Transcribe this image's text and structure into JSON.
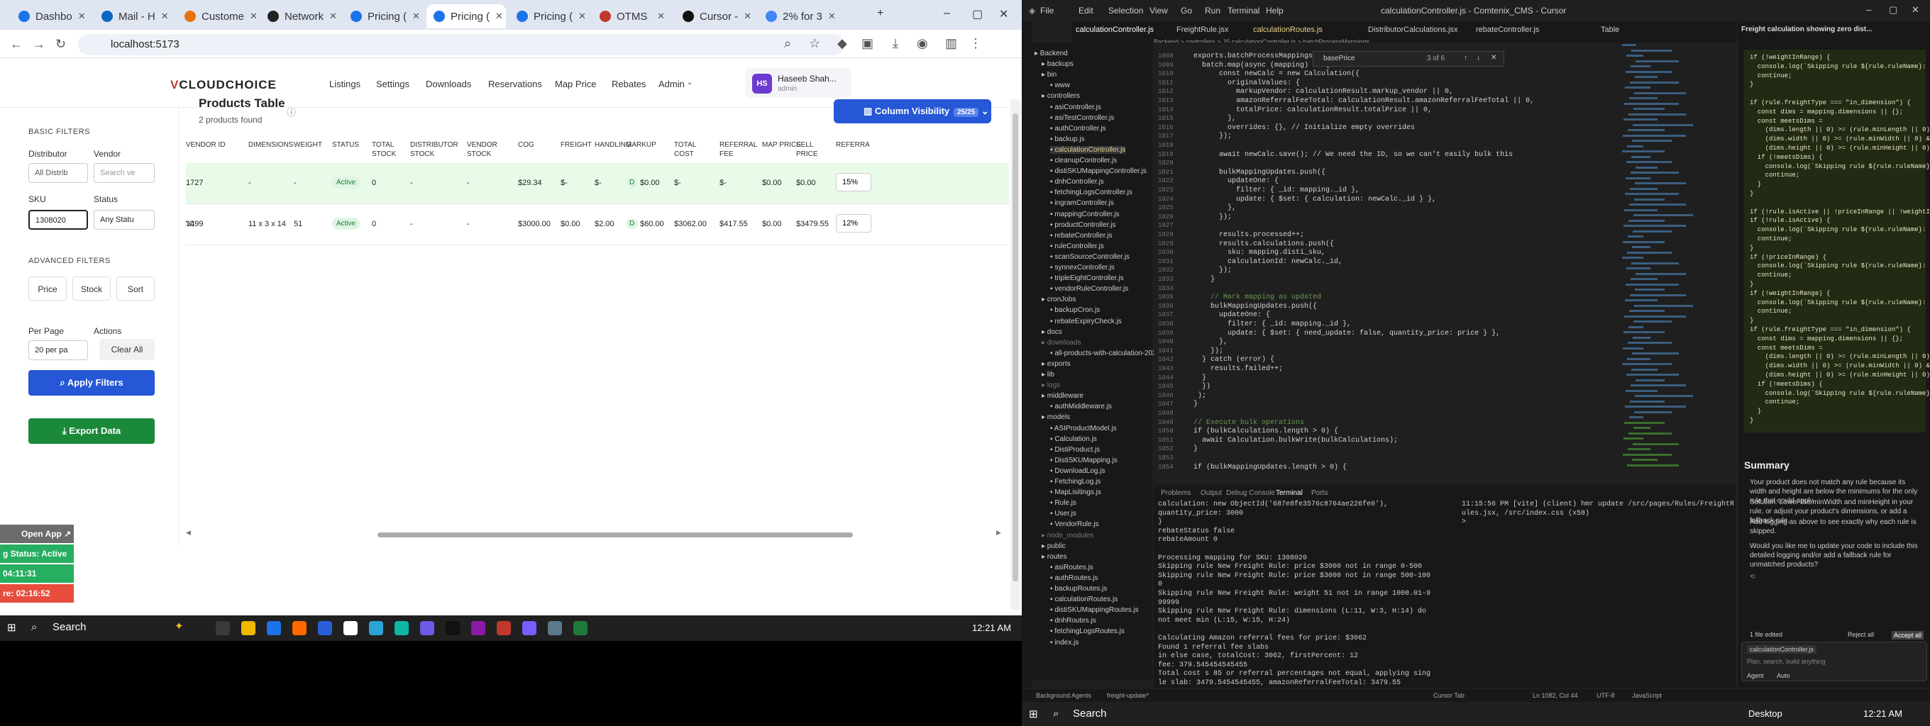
{
  "browser": {
    "tabs": [
      {
        "label": "Dashbo",
        "color": "#1a73e8"
      },
      {
        "label": "Mail - H",
        "color": "#0a66c2"
      },
      {
        "label": "Custome",
        "color": "#e8710a"
      },
      {
        "label": "Network",
        "color": "#222222"
      },
      {
        "label": "Pricing (",
        "color": "#1a73e8"
      },
      {
        "label": "Pricing (",
        "color": "#1a73e8"
      },
      {
        "label": "Pricing (",
        "color": "#1a73e8"
      },
      {
        "label": "OTMS",
        "color": "#c0392b"
      },
      {
        "label": "Cursor -",
        "color": "#111111"
      },
      {
        "label": "2% for 3",
        "color": "#4285f4"
      }
    ],
    "url": "localhost:5173"
  },
  "app": {
    "logo_v": "V",
    "logo_rest": "CLOUDCHOICE",
    "nav": [
      "Listings",
      "Settings",
      "Downloads",
      "Reservations",
      "Map Price",
      "Rebates",
      "Admin"
    ],
    "user_initials": "HS",
    "user_name": "Haseeb Shah...",
    "user_role": "admin"
  },
  "filters": {
    "basic_title": "BASIC FILTERS",
    "distributor_label": "Distributor",
    "distributor_value": "All Distrib",
    "vendor_label": "Vendor",
    "vendor_placeholder": "Search ve",
    "sku_label": "SKU",
    "sku_value": "1308020",
    "status_label": "Status",
    "status_value": "Any Statu",
    "advanced_title": "ADVANCED FILTERS",
    "price_btn": "Price",
    "stock_btn": "Stock",
    "sort_btn": "Sort",
    "per_page_label": "Per Page",
    "per_page_value": "20 per pa",
    "actions_label": "Actions",
    "clear_all": "Clear All",
    "apply": "Apply Filters",
    "export": "Export Data"
  },
  "products": {
    "title": "Products Table",
    "count": "2 products found",
    "column_visibility": "Column Visibility",
    "column_badge": "25/25",
    "headers": [
      "VENDOR ID",
      "DIMENSIONS",
      "WEIGHT",
      "STATUS",
      "TOTAL STOCK",
      "DISTRIBUTOR STOCK",
      "VENDOR STOCK",
      "COG",
      "FREIGHT",
      "HANDLING",
      "MARKUP",
      "TOTAL COST",
      "REFERRAL FEE",
      "MAP PRICE",
      "SELL PRICE",
      "REFERRA"
    ],
    "rows": [
      {
        "prefix": "",
        "vendor_id": "1727",
        "dims": "-",
        "weight": "-",
        "status": "Active",
        "total_stock": "0",
        "dist_stock": "-",
        "vendor_stock": "-",
        "cog": "$29.34",
        "freight": "$-",
        "handling": "$-",
        "markup_badge": "D",
        "markup": "$0.00",
        "total_cost": "$-",
        "referral": "$-",
        "map": "$0.00",
        "sell": "$0.00",
        "ref_pct": "15%"
      },
      {
        "prefix": "VIC",
        "vendor_id": "1499",
        "dims": "11 x 3 x 14",
        "weight": "51",
        "status": "Active",
        "total_stock": "0",
        "dist_stock": "-",
        "vendor_stock": "-",
        "cog": "$3000.00",
        "freight": "$0.00",
        "handling": "$2.00",
        "markup_badge": "D",
        "markup": "$60.00",
        "total_cost": "$3062.00",
        "referral": "$417.55",
        "map": "$0.00",
        "sell": "$3479.55",
        "ref_pct": "12%"
      }
    ]
  },
  "overlay": {
    "open_app": "Open App",
    "status_active": "g Status: Active",
    "timer1": "04:11:31",
    "timer2": "re: 02:16:52"
  },
  "taskbar": {
    "search": "Search",
    "time_left": "12:21 AM",
    "time_right": "12:21 AM",
    "desktop": "Desktop"
  },
  "vscode": {
    "window_title": "calculationController.js - Comtenix_CMS - Cursor",
    "menu": [
      "File",
      "Edit",
      "Selection",
      "View",
      "Go",
      "Run",
      "Terminal",
      "Help"
    ],
    "tabs": [
      "calculationController.js",
      "FreightRule.jsx",
      "calculationRoutes.js",
      "DistributorCalculations.jsx",
      "rebateController.js",
      "Table"
    ],
    "breadcrumb": "Backend > controllers > JS calculationController.js > batchProcessMappings",
    "find_text": "basePrice",
    "find_count": "3 of 6",
    "explorer": [
      "Backend",
      "backups",
      "bin",
      "www",
      "controllers",
      "asiController.js",
      "asiTestController.js",
      "authController.js",
      "backup.js",
      "calculationController.js",
      "cleanupController.js",
      "distiSKUMappingController.js",
      "dnhController.js",
      "fetchingLogsController.js",
      "ingramController.js",
      "mappingController.js",
      "productController.js",
      "rebateController.js",
      "ruleController.js",
      "scanSourceController.js",
      "synnexController.js",
      "tripleEightController.js",
      "vendorRuleController.js",
      "cronJobs",
      "backupCron.js",
      "rebateExpiryCheck.js",
      "docs",
      "downloads",
      "all-products-with-calculation-2025",
      "exports",
      "lib",
      "logs",
      "middleware",
      "authMiddleware.js",
      "models",
      "ASIProductModel.js",
      "Calculation.js",
      "DistiProduct.js",
      "DistiSKUMapping.js",
      "DownloadLog.js",
      "FetchingLog.js",
      "MapLisitings.js",
      "Rule.js",
      "User.js",
      "VendorRule.js",
      "node_modules",
      "public",
      "routes",
      "asiRoutes.js",
      "authRoutes.js",
      "backupRoutes.js",
      "calculationRoutes.js",
      "distiSKUMappingRoutes.js",
      "dnhRoutes.js",
      "fetchingLogsRoutes.js",
      "index.js"
    ],
    "code": [
      "exports.batchProcessMappings = async (mappings, distiName) => {",
      "  batch.map(async (mapping) => {",
      "      const newCalc = new Calculation({",
      "        originalValues: {",
      "          markupVendor: calculationResult.markup_vendor || 0,",
      "          amazonReferralFeeTotal: calculationResult.amazonReferralFeeTotal || 0,",
      "          totalPrice: calculationResult.totalPrice || 0,",
      "        },",
      "        overrides: {}, // Initialize empty overrides",
      "      });",
      "",
      "      await newCalc.save(); // We need the ID, so we can't easily bulk this",
      "",
      "      bulkMappingUpdates.push({",
      "        updateOne: {",
      "          filter: { _id: mapping._id },",
      "          update: { $set: { calculation: newCalc._id } },",
      "        },",
      "      });",
      "",
      "      results.processed++;",
      "      results.calculations.push({",
      "        sku: mapping.disti_sku,",
      "        calculationId: newCalc._id,",
      "      });",
      "    }",
      "",
      "    // Mark mapping as updated",
      "    bulkMappingUpdates.push({",
      "      updateOne: {",
      "        filter: { _id: mapping._id },",
      "        update: { $set: { need_update: false, quantity_price: price } },",
      "      },",
      "    });",
      "  } catch (error) {",
      "    results.failed++;",
      "  }",
      "  })",
      " );",
      "}",
      "",
      "// Execute bulk operations",
      "if (bulkCalculations.length > 0) {",
      "  await Calculation.bulkWrite(bulkCalculations);",
      "}",
      "",
      "if (bulkMappingUpdates.length > 0) {"
    ],
    "line_start": "1008",
    "panel_tabs": [
      "Problems",
      "Output",
      "Debug Console",
      "Terminal",
      "Ports"
    ],
    "terminal_left": [
      "calculation: new ObjectId('687e8fe3576c8764ae226fe0'),",
      "quantity_price: 3000",
      "}",
      "rebateStatus false",
      "rebateAmount 0",
      "",
      "Processing mapping for SKU: 1308020",
      "Skipping rule New Freight Rule: price $3000 not in range 0-500",
      "Skipping rule New Freight Rule: price $3000 not in range 500-100",
      "0",
      "Skipping rule New Freight Rule: weight 51 not in range 1000.01-9",
      "99999",
      "Skipping rule New Freight Rule: dimensions (L:11, W:3, H:14) do",
      "not meet min (L:15, W:15, H:24)",
      "",
      "Calculating Amazon referral fees for price: $3062",
      "Found 1 referral fee slabs",
      "in else case, totalCost: 3062, firstPercent: 12",
      "fee: 379.545454545455",
      "Total cost s 85 or referral percentages not equal, applying sing",
      "le slab: 3479.5454545455, amazonReferralFeeTotal: 3479.55"
    ],
    "terminal_right": [
      "11:15:56 PM [vite] (client) hmr update /src/pages/Rules/FreightR",
      "ules.jsx, /src/index.css (x58)",
      ">"
    ],
    "chat_title": "Freight calculation showing zero dist...",
    "chat_code": [
      "if (!weightInRange) {",
      "  console.log(`Skipping rule ${rule.ruleName}: weight",
      "  continue;",
      "}",
      "",
      "if (rule.freightType === \"in_dimension\") {",
      "  const dims = mapping.dimensions || {};",
      "  const meetsDims =",
      "    (dims.length || 0) >= (rule.minLength || 0) &&",
      "    (dims.width || 0) >= (rule.minWidth || 0) &&",
      "    (dims.height || 0) >= (rule.minHeight || 0);",
      "  if (!meetsDims) {",
      "    console.log(`Skipping rule ${rule.ruleName}: dimen",
      "    continue;",
      "  }",
      "}",
      "",
      "if (!rule.isActive || !priceInRange || !weightInRange)",
      "if (!rule.isActive) {",
      "  console.log(`Skipping rule ${rule.ruleName}: not act",
      "  continue;",
      "}",
      "if (!priceInRange) {",
      "  console.log(`Skipping rule ${rule.ruleName}: price $",
      "  continue;",
      "}",
      "if (!weightInRange) {",
      "  console.log(`Skipping rule ${rule.ruleName}: weight",
      "  continue;",
      "}",
      "if (rule.freightType === \"in_dimension\") {",
      "  const dims = mapping.dimensions || {};",
      "  const meetsDims =",
      "    (dims.length || 0) >= (rule.minLength || 0) &&",
      "    (dims.width || 0) >= (rule.minWidth || 0) &&",
      "    (dims.height || 0) >= (rule.minHeight || 0);",
      "  if (!meetsDims) {",
      "    console.log(`Skipping rule ${rule.ruleName}: dimen",
      "    continue;",
      "  }",
      "}"
    ],
    "summary_title": "Summary",
    "summary_bullets": [
      "Your product does not match any rule because its width and height are below the minimums for the only rule that could apply.",
      "Solution: Lower the minWidth and minHeight in your rule, or adjust your product's dimensions, or add a fallback rule.",
      "Add logging as above to see exactly why each rule is skipped."
    ],
    "summary_question": "Would you like me to update your code to include this detailed logging and/or add a fallback rule for unmatched products?",
    "chat_file": "calculationController.js",
    "chat_placeholder": "Plan, search, build anything",
    "chat_mode": "Agent",
    "chat_model": "Auto",
    "files_edited": "1 file edited",
    "reject_all": "Reject all",
    "accept_all": "Accept all",
    "status_left": "Background Agents",
    "status_branch": "freight-update*",
    "status_pos": "Ln 1082, Col 44",
    "status_enc": "UTF-8",
    "status_lang": "JavaScript",
    "status_cursor": "Cursor Tab",
    "taskbar_search": "Search"
  }
}
